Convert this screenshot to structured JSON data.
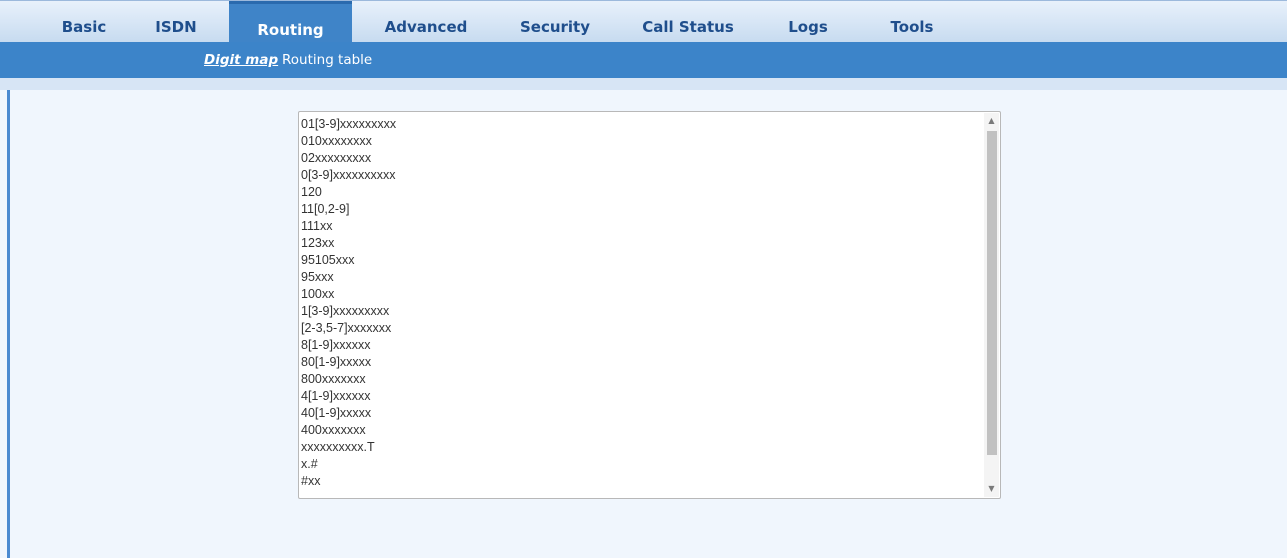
{
  "topnav": {
    "tabs": [
      {
        "label": "Basic"
      },
      {
        "label": "ISDN"
      },
      {
        "label": "Routing"
      },
      {
        "label": "Advanced"
      },
      {
        "label": "Security"
      },
      {
        "label": "Call Status"
      },
      {
        "label": "Logs"
      },
      {
        "label": "Tools"
      }
    ],
    "active_tab": "Routing"
  },
  "subnav": {
    "items": [
      {
        "label": "Digit map"
      },
      {
        "label": "Routing table"
      }
    ],
    "active_item": "Digit map"
  },
  "digit_map": {
    "lines": [
      "01[3-9]xxxxxxxxx",
      "010xxxxxxxx",
      "02xxxxxxxxx",
      "0[3-9]xxxxxxxxxx",
      "120",
      "11[0,2-9]",
      "111xx",
      "123xx",
      "95105xxx",
      "95xxx",
      "100xx",
      "1[3-9]xxxxxxxxx",
      "[2-3,5-7]xxxxxxx",
      "8[1-9]xxxxxx",
      "80[1-9]xxxxx",
      "800xxxxxxx",
      "4[1-9]xxxxxx",
      "40[1-9]xxxxx",
      "400xxxxxxx",
      "xxxxxxxxxx.T",
      "x.#",
      "#xx"
    ]
  },
  "colors": {
    "nav_active": "#3f84c8",
    "nav_text": "#1f4e8c",
    "subnav_bg": "#3c84c9",
    "content_bg": "#f0f6fd"
  }
}
